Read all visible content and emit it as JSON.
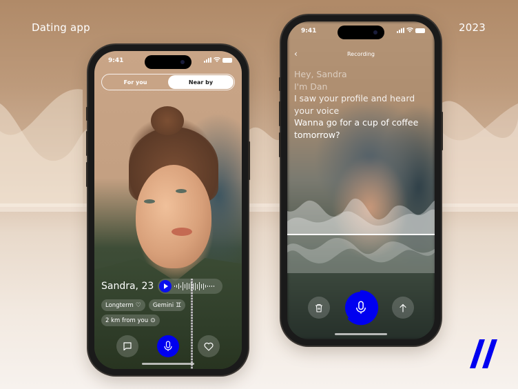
{
  "page": {
    "title": "Dating app",
    "year": "2023",
    "brand_color": "#0000f0",
    "logo_icon": "double-slash-logo"
  },
  "profile_screen": {
    "status_bar": {
      "time": "9:41"
    },
    "tabs": [
      {
        "label": "For you",
        "active": false
      },
      {
        "label": "Near by",
        "active": true
      }
    ],
    "profile": {
      "name": "Sandra, 23",
      "voice_note_icon": "play-icon",
      "tags": [
        {
          "label": "Longterm",
          "icon": "heart-outline-icon",
          "glyph": "♡"
        },
        {
          "label": "Gemini",
          "icon": "gemini-icon",
          "glyph": "♊"
        },
        {
          "label": "2 km from you",
          "icon": "location-pin-icon",
          "glyph": "⊙"
        }
      ]
    },
    "actions": [
      {
        "name": "message",
        "icon": "chat-bubble-icon"
      },
      {
        "name": "voice",
        "icon": "microphone-icon"
      },
      {
        "name": "like",
        "icon": "heart-icon"
      }
    ]
  },
  "recording_screen": {
    "status_bar": {
      "time": "9:41"
    },
    "nav": {
      "back_glyph": "‹",
      "title": "Recording"
    },
    "transcript": [
      {
        "text": "Hey, Sandra",
        "tone": "faded"
      },
      {
        "text": "I'm Dan",
        "tone": "faded"
      },
      {
        "text": "I saw your profile and heard your voice",
        "tone": "mid"
      },
      {
        "text": "Wanna go for a cup of coffee tomorrow?",
        "tone": "bright"
      }
    ],
    "actions": [
      {
        "name": "delete",
        "icon": "trash-icon"
      },
      {
        "name": "record",
        "icon": "microphone-icon"
      },
      {
        "name": "send",
        "icon": "arrow-up-icon"
      }
    ]
  }
}
